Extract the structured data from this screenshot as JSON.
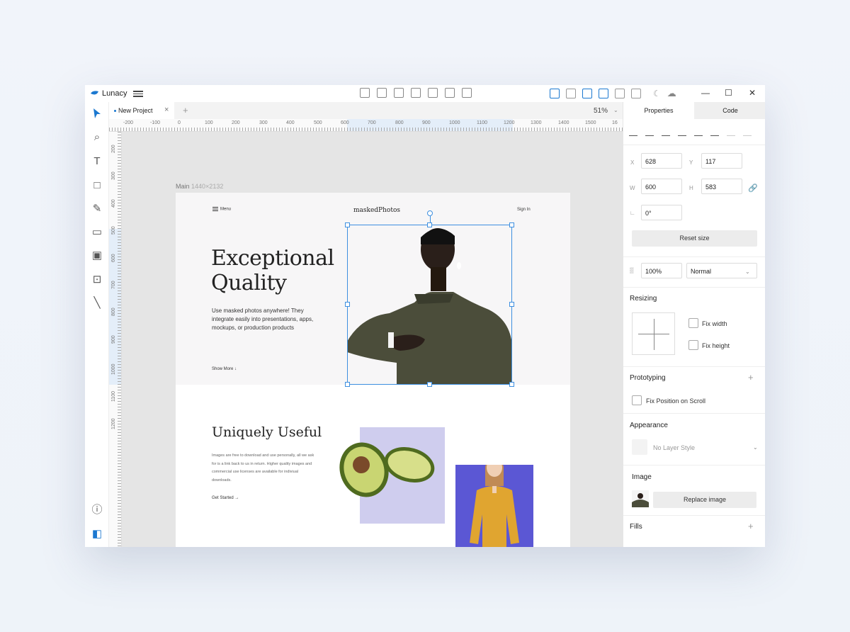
{
  "app": {
    "title": "Lunacy"
  },
  "tabs": [
    {
      "label": "New Project",
      "close": "×"
    }
  ],
  "tab_add": "+",
  "zoom": "51%",
  "ruler_top_labels": [
    "-200",
    "-100",
    "0",
    "100",
    "200",
    "300",
    "400",
    "500",
    "600",
    "700",
    "800",
    "900",
    "1000",
    "1100",
    "1200",
    "1300",
    "1400",
    "1500",
    "16"
  ],
  "ruler_left_labels": [
    "200",
    "300",
    "400",
    "500",
    "600",
    "700",
    "800",
    "900",
    "1000",
    "1100",
    "1200"
  ],
  "artboard": {
    "label": "Main",
    "dims": "1440×2132",
    "menu": "Menu",
    "logo": "maskedPhotos",
    "signin": "Sign In",
    "hero_title_1": "Exceptional",
    "hero_title_2": "Quality",
    "hero_desc": "Use masked photos anywhere! They integrate easily into presentations, apps, mockups, or production products",
    "show_more": "Show More",
    "section2_title": "Uniquely Useful",
    "section2_desc": "Images are free to download and use personally, all we ask for is a link back to us in return. Higher quality images and commercial use licenses are available for indiviual downloads.",
    "get_started": "Get Started"
  },
  "panel": {
    "tab_properties": "Properties",
    "tab_code": "Code",
    "x_label": "X",
    "x_value": "628",
    "y_label": "Y",
    "y_value": "117",
    "w_label": "W",
    "w_value": "600",
    "h_label": "H",
    "h_value": "583",
    "rotation_value": "0°",
    "reset_size": "Reset size",
    "opacity": "100%",
    "blend_mode": "Normal",
    "resizing": "Resizing",
    "fix_width": "Fix width",
    "fix_height": "Fix height",
    "prototyping": "Prototyping",
    "fix_position": "Fix Position on Scroll",
    "appearance": "Appearance",
    "layer_style": "No Layer Style",
    "image": "Image",
    "replace_image": "Replace image",
    "fills": "Fills"
  },
  "colors": {
    "accent": "#1b78d0",
    "selection": "#3d8fe0",
    "lavender": "#cfcdee",
    "violet": "#5b57d4"
  }
}
